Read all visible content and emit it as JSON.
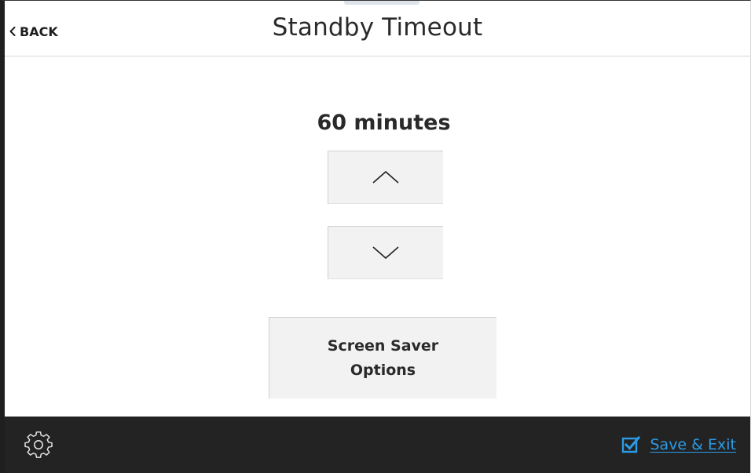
{
  "header": {
    "back_label": "BACK",
    "title": "Standby Timeout"
  },
  "timeout": {
    "value_text": "60 minutes"
  },
  "stepper": {
    "up_icon": "chevron-up-icon",
    "down_icon": "chevron-down-icon"
  },
  "screensaver": {
    "label_line1": "Screen Saver",
    "label_line2": "Options"
  },
  "footer": {
    "settings_icon": "gear-icon",
    "save_label": "Save & Exit",
    "save_icon": "checkbox-checked-icon"
  },
  "colors": {
    "accent": "#2b9be6",
    "footer_bg": "#232323",
    "button_bg": "#f2f2f2"
  }
}
